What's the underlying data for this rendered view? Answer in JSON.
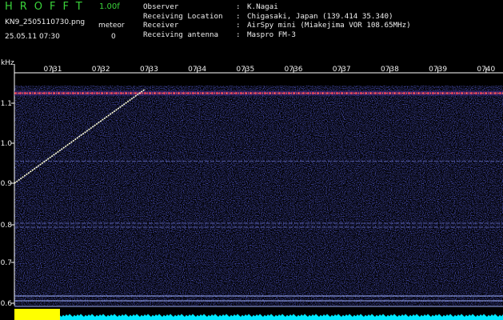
{
  "header": {
    "app_title": "HROFFT",
    "version": "1.00f",
    "filename": "KN9_2505110730.png",
    "datetime": "25.05.11 07:30",
    "meteor_label": "meteor",
    "meteor_count": "0"
  },
  "info": [
    {
      "key": "Observer",
      "value": "K.Nagai"
    },
    {
      "key": "Receiving Location",
      "value": "Chigasaki, Japan (139.414 35.340)"
    },
    {
      "key": "Receiver",
      "value": "AirSpy mini (Miakejima VOR 108.65MHz)"
    },
    {
      "key": "Receiving antenna",
      "value": "Maspro FM-3"
    }
  ],
  "y_unit": "kHz",
  "colors": {
    "background": "#000000",
    "noise": "#1f1fa8",
    "carrier": "#e6405a",
    "meteor_trail": "#ffffd8",
    "yellow_block": "#ffff00",
    "cyan_noise": "#00e8ff",
    "label_green": "#3ad33a"
  },
  "chart_data": {
    "type": "heatmap",
    "x_ticks": [
      "0731",
      "0732",
      "0733",
      "0734",
      "0735",
      "0736",
      "0737",
      "0738",
      "0739",
      "0740"
    ],
    "y_ticks": [
      "1.1",
      "1.0",
      "0.9",
      "0.8",
      "0.7",
      "0.6"
    ],
    "ylim": [
      0.6,
      1.14
    ],
    "carrier_khz": 1.125,
    "faint_lines_khz": [
      0.8,
      0.79,
      0.955
    ],
    "trail": {
      "start_minute": 0.0,
      "start_khz": 0.9,
      "end_minute": 2.05,
      "end_khz": 1.135
    }
  }
}
